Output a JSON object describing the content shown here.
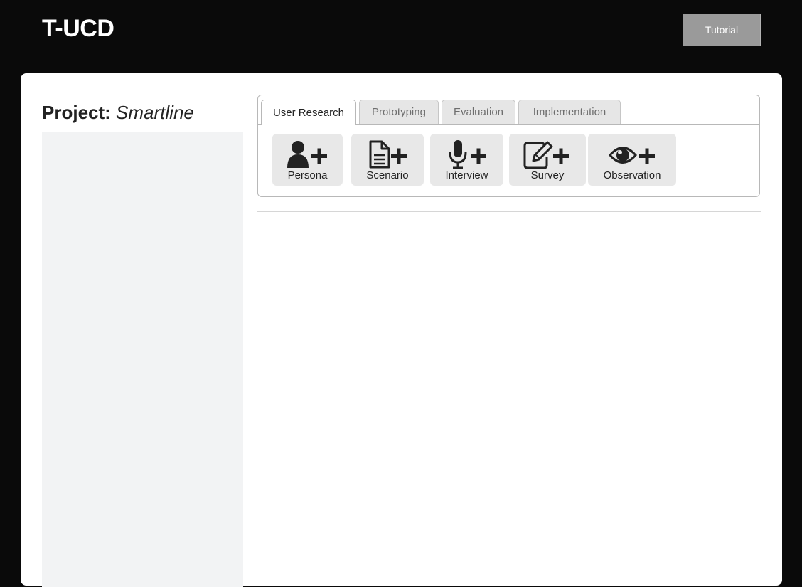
{
  "header": {
    "logo": "T-UCD",
    "tutorial_label": "Tutorial"
  },
  "project": {
    "label": "Project:",
    "name": "Smartline"
  },
  "tabs": [
    {
      "label": "User Research",
      "active": true
    },
    {
      "label": "Prototyping",
      "active": false
    },
    {
      "label": "Evaluation",
      "active": false
    },
    {
      "label": "Implementation",
      "active": false
    }
  ],
  "tools": [
    {
      "label": "Persona",
      "icon": "user-plus-icon"
    },
    {
      "label": "Scenario",
      "icon": "file-plus-icon"
    },
    {
      "label": "Interview",
      "icon": "microphone-plus-icon"
    },
    {
      "label": "Survey",
      "icon": "edit-plus-icon"
    },
    {
      "label": "Observation",
      "icon": "eye-plus-icon"
    }
  ],
  "colors": {
    "background": "#0a0a0a",
    "card": "#ffffff",
    "sidebar": "#f2f3f4",
    "tool_button": "#e8e8e8",
    "tutorial_button": "#9a9a9a"
  }
}
